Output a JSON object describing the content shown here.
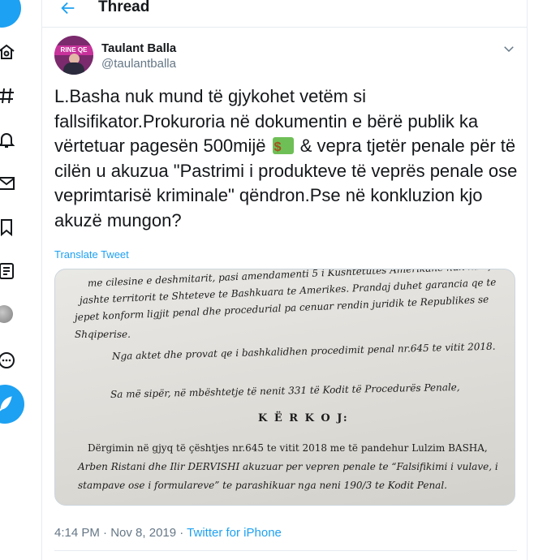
{
  "header": {
    "title": "Thread"
  },
  "tweet": {
    "author_name": "Taulant Balla",
    "author_handle": "@taulantballa",
    "avatar_text": "RINE QE",
    "text_part1": "L.Basha nuk mund të gjykohet vetëm si fallsifikator.Prokuroria në dokumentin e bërë publik ka vërtetuar pagesën 500mijë",
    "emoji": "💵",
    "text_part2": " & vepra tjetër penale për të cilën u akuzua \"Pastrimi i produkteve të veprës penale ose veprimtarisë kriminale\" qëndron.Pse në konkluzion kjo akuzë mungon?",
    "translate_label": "Translate Tweet",
    "time": "4:14 PM",
    "separator": " · ",
    "date": "Nov 8, 2019",
    "source": "Twitter for iPhone"
  },
  "document": {
    "lines": [
      "me cilesine e deshmitarit, pasi amendamenti 5 i Kushtetutes Amerikane nuk ka efekt",
      "jashte territorit te Shteteve te Bashkuara te Amerikes. Prandaj duhet garancia qe te",
      "jepet konform ligjit penal dhe procedurial pa cenuar rendin juridik te Republikes se",
      "Shqiperise.",
      "Nga aktet dhe provat qe i bashkalidhen procedimit penal nr.645 te vitit 2018.",
      "Sa më sipër, në mbështetje të nenit 331 të Kodit të Procedurës Penale,",
      "K Ë R K O J:",
      "Dërgimin në gjyq të çështjes nr.645 te vitit 2018 me të pandehur Lulzim BASHA,",
      "Arben Ristani dhe Ilir DERVISHI akuzuar per vepren penale te “Falsifikimi i vulave, i",
      "stampave ose i formulareve” te parashikuar nga neni 190/3 te Kodit Penal."
    ]
  },
  "nav": {
    "icons": [
      "twitter-logo-icon",
      "home-icon",
      "hashtag-icon",
      "bell-icon",
      "mail-icon",
      "bookmark-icon",
      "list-icon",
      "profile-avatar",
      "more-icon",
      "compose-icon"
    ]
  },
  "colors": {
    "accent": "#1da1f2",
    "secondary_text": "#657786",
    "border": "#e6ecf0"
  }
}
